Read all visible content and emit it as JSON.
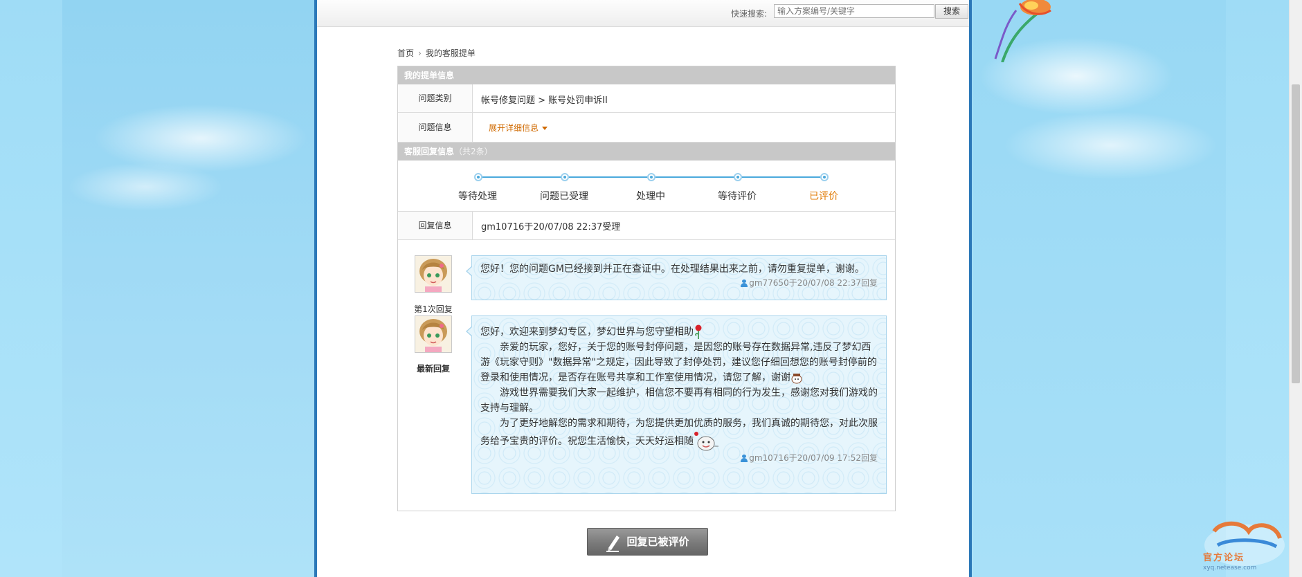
{
  "search": {
    "label": "快速搜索:",
    "placeholder": "输入方案编号/关键字",
    "button_label": "搜索"
  },
  "breadcrumb": {
    "home": "首页",
    "current": "我的客服提单"
  },
  "ticket_info": {
    "title": "我的提单信息",
    "category_label": "问题类别",
    "category_value": "帐号修复问题 > 账号处罚申诉II",
    "info_label": "问题信息",
    "info_expand": "展开详细信息"
  },
  "reply_section": {
    "title": "客服回复信息",
    "count": "（共2条）"
  },
  "progress": {
    "steps": [
      "等待处理",
      "问题已受理",
      "处理中",
      "等待评价",
      "已评价"
    ],
    "active_step": "已评价"
  },
  "reply_info": {
    "label": "回复信息",
    "value": "gm10716于20/07/08 22:37受理"
  },
  "replies": [
    {
      "tag": "第1次回复",
      "text": "您好！您的问题GM已经接到并正在查证中。在处理结果出来之前，请勿重复提单，谢谢。",
      "signature": "gm77650于20/07/08 22:37回复"
    },
    {
      "tag": "最新回复",
      "line1": "您好，欢迎来到梦幻专区，梦幻世界与您守望相助",
      "para1": "亲爱的玩家，您好，关于您的账号封停问题，是因您的账号存在数据异常,违反了梦幻西游《玩家守则》\"数据异常\"之规定，因此导致了封停处罚，建议您仔细回想您的账号封停前的登录和使用情况，是否存在账号共享和工作室使用情况，请您了解，谢谢",
      "para2": "游戏世界需要我们大家一起维护，相信您不要再有相同的行为发生，感谢您对我们游戏的支持与理解。",
      "para3": "为了更好地解您的需求和期待，为您提供更加优质的服务，我们真诚的期待您，对此次服务给予宝贵的评价。祝您生活愉快，天天好运相随",
      "signature": "gm10716于20/07/09 17:52回复"
    }
  ],
  "evaluate_button": "回复已被评价",
  "logo": {
    "text": "官方论坛",
    "url": "xyq.netease.com"
  },
  "colors": {
    "accent_orange": "#e07800",
    "progress_blue": "#4aa9dc",
    "frame_blue": "#2b78b8",
    "section_gray": "#c8c8c8"
  }
}
